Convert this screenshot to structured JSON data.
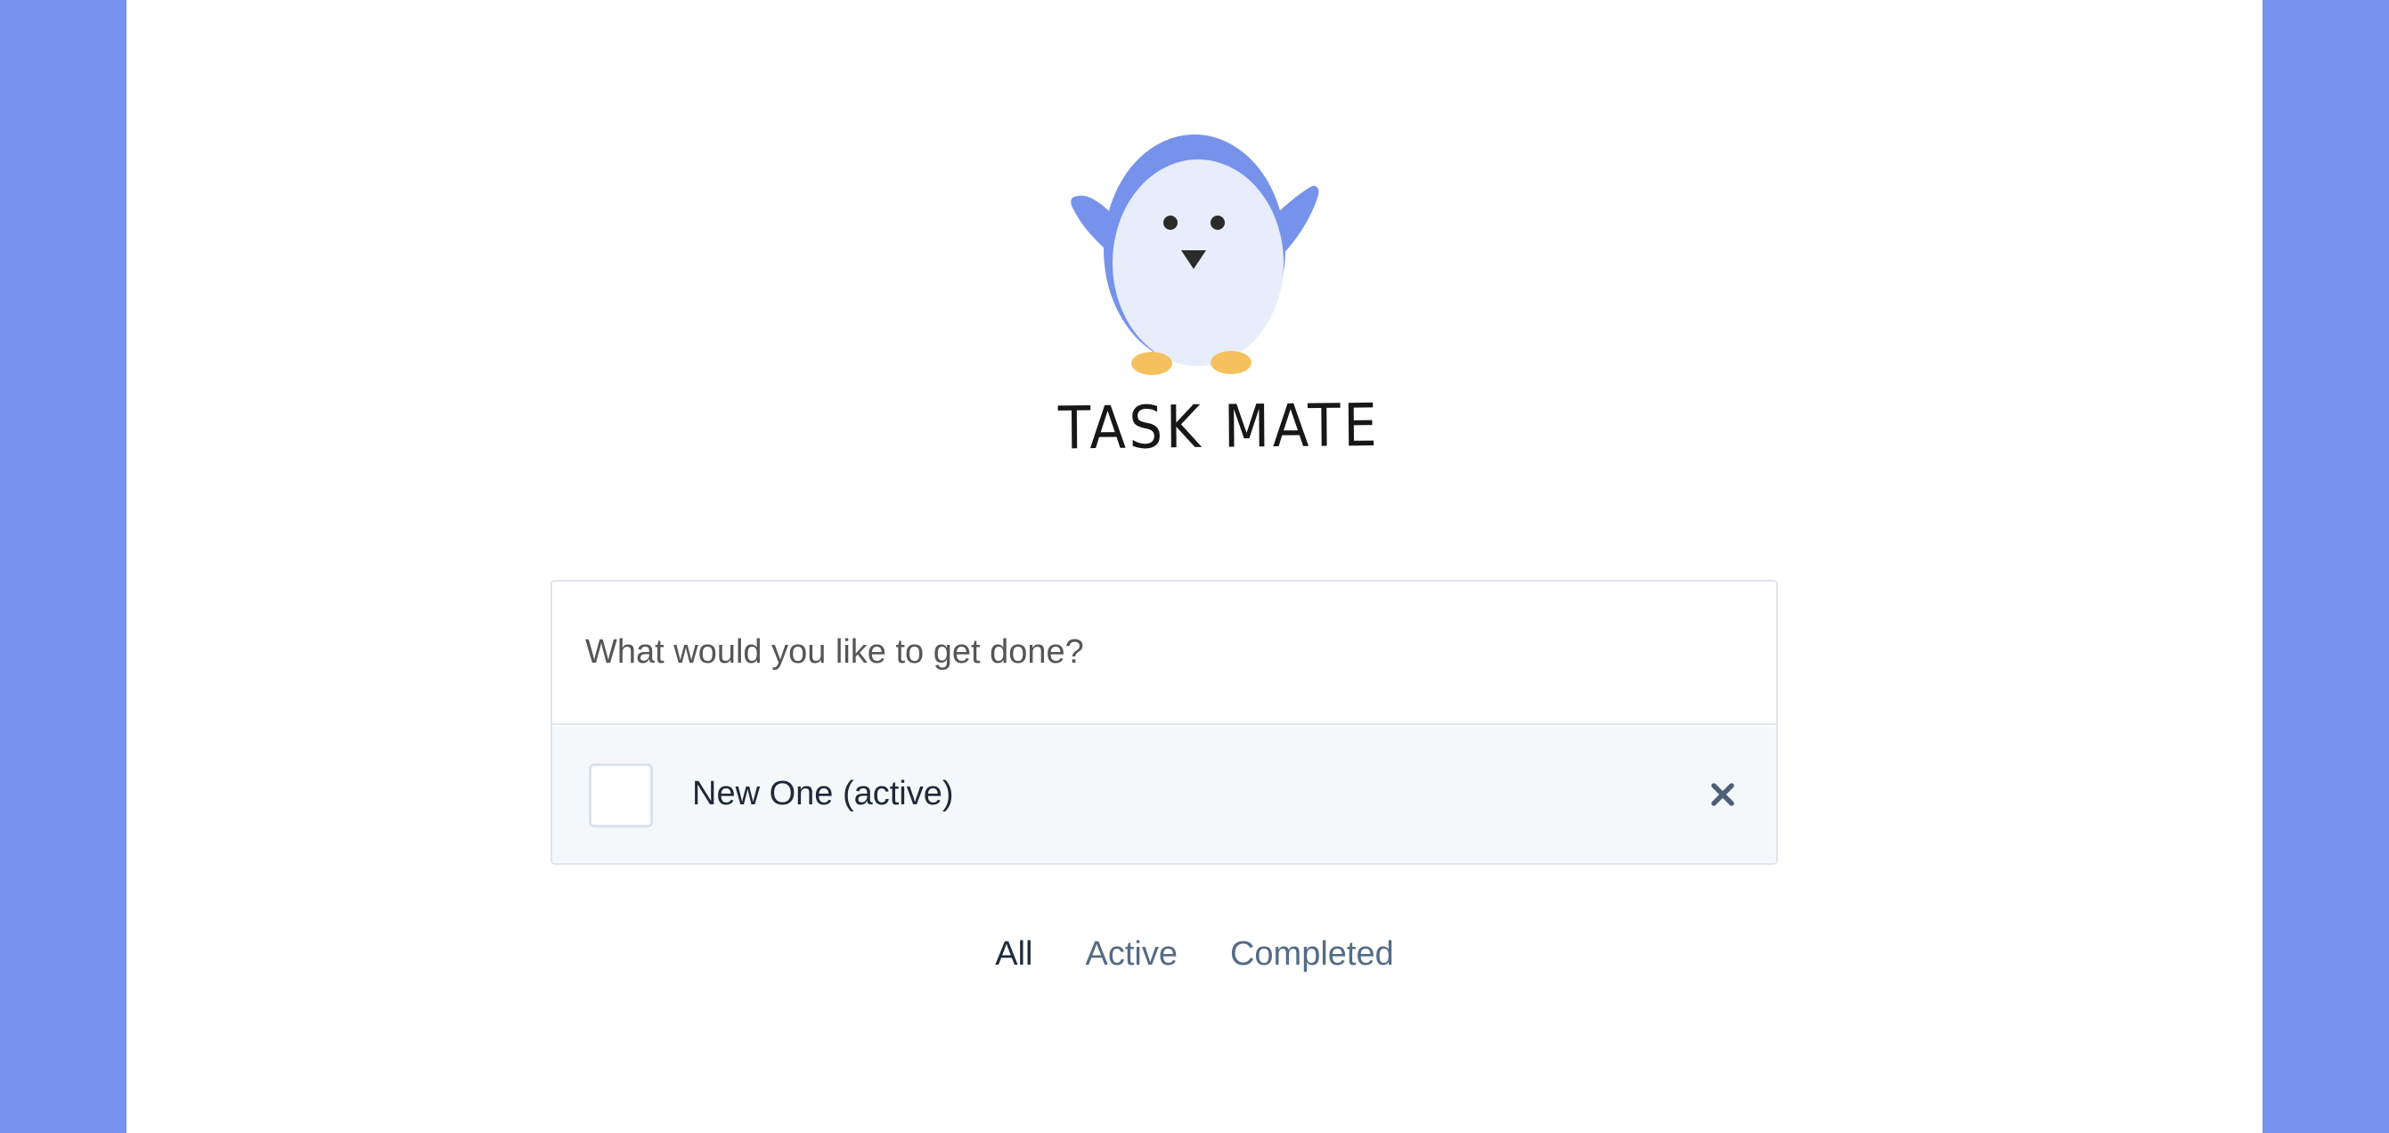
{
  "app": {
    "title": "TASK MATE"
  },
  "logo": {
    "icon": "penguin-icon"
  },
  "new_task": {
    "placeholder": "What would you like to get done?",
    "value": ""
  },
  "tasks": [
    {
      "label": "New One (active)",
      "completed": false,
      "delete_icon": "close-icon"
    }
  ],
  "filters": {
    "items": [
      {
        "label": "All",
        "active": true
      },
      {
        "label": "Active",
        "active": false
      },
      {
        "label": "Completed",
        "active": false
      }
    ]
  },
  "colors": {
    "accent": "#7892ef",
    "card_border": "#dfe5ed",
    "task_background": "#f5f8fa",
    "filter_text": "#546b86"
  }
}
